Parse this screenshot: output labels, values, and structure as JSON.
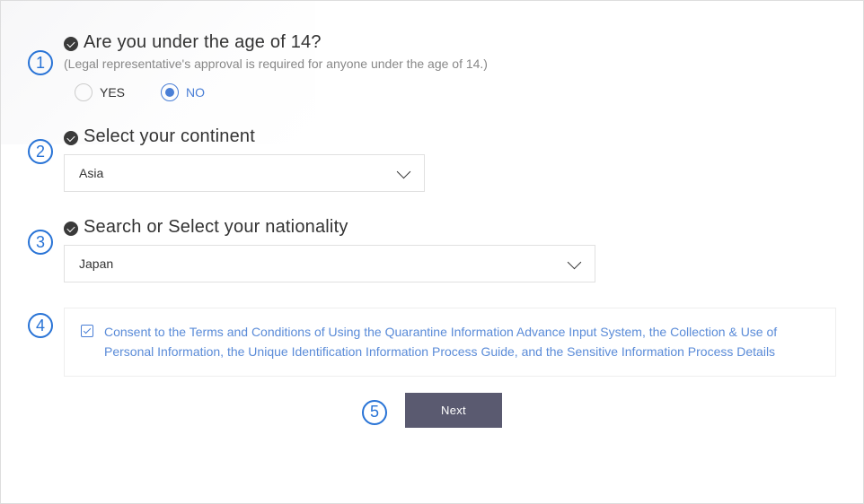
{
  "badges": [
    "1",
    "2",
    "3",
    "4",
    "5"
  ],
  "q1": {
    "title": "Are you under the age of 14?",
    "sub": "(Legal representative's approval is required for anyone under the age of 14.)",
    "yes": "YES",
    "no": "NO",
    "selected": "no"
  },
  "q2": {
    "title": "Select your continent",
    "value": "Asia"
  },
  "q3": {
    "title": "Search or Select your nationality",
    "value": "Japan"
  },
  "consent": {
    "text": "Consent to the Terms and Conditions of Using the Quarantine Information Advance Input System, the Collection & Use of Personal Information, the Unique Identification Information Process Guide, and the Sensitive Information Process Details",
    "checked": true
  },
  "next": {
    "label": "Next"
  }
}
